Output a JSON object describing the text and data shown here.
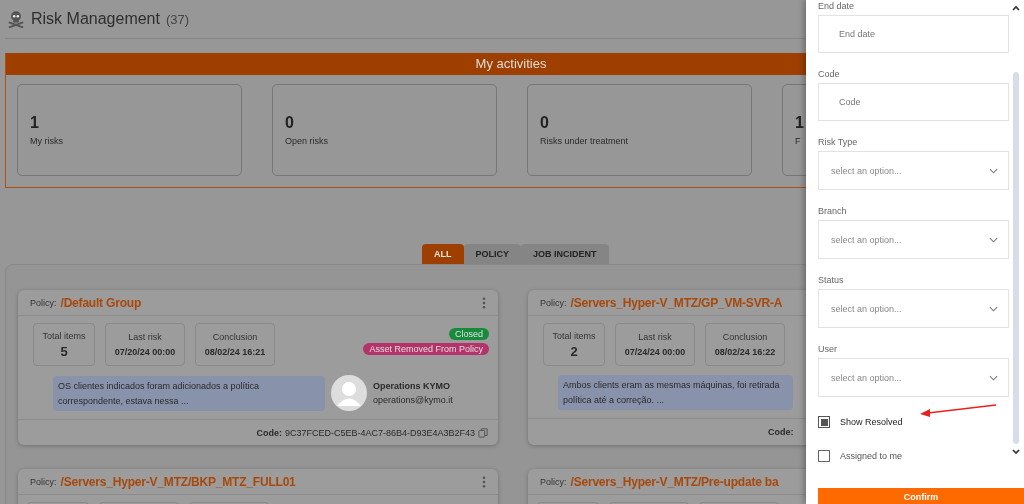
{
  "page": {
    "title": "Risk Management",
    "count": "(37)"
  },
  "activities": {
    "title": "My activities",
    "stats": [
      {
        "value": "1",
        "label": "My risks"
      },
      {
        "value": "0",
        "label": "Open risks"
      },
      {
        "value": "0",
        "label": "Risks under treatment"
      },
      {
        "value": "1",
        "label": "F"
      }
    ]
  },
  "tabs": [
    {
      "label": "ALL",
      "selected": true
    },
    {
      "label": "POLICY",
      "selected": false
    },
    {
      "label": "JOB INCIDENT",
      "selected": false
    }
  ],
  "policies": [
    {
      "policy_label": "Policy:",
      "name": "/Default Group",
      "metrics": [
        {
          "label": "Total items",
          "value": "5",
          "kind": "count"
        },
        {
          "label": "Last risk",
          "value": "07/20/24 00:00",
          "kind": "date"
        },
        {
          "label": "Conclusion",
          "value": "08/02/24 16:21",
          "kind": "date"
        }
      ],
      "badges": [
        {
          "text": "Closed",
          "color": "#178a3c"
        },
        {
          "text": "Asset Removed From Policy",
          "color": "#b3336a"
        }
      ],
      "comment": "OS clientes indicados foram adicionados a política correspondente, estava nessa ...",
      "user": {
        "name": "Operations KYMO",
        "email": "operations@kymo.it"
      },
      "code_label": "Code:",
      "code": "9C37FCED-C5EB-4AC7-86B4-D93E4A3B2F43"
    },
    {
      "policy_label": "Policy:",
      "name": "/Servers_Hyper-V_MTZ/GP_VM-SVR-A",
      "metrics": [
        {
          "label": "Total items",
          "value": "2",
          "kind": "count"
        },
        {
          "label": "Last risk",
          "value": "07/24/24 00:00",
          "kind": "date"
        },
        {
          "label": "Conclusion",
          "value": "08/02/24 16:22",
          "kind": "date"
        }
      ],
      "comment": "Ambos clients eram as mesmas máquinas, foi retirada política até a correção. ...",
      "code_label": "Code:"
    },
    {
      "policy_label": "Policy:",
      "name": "/Servers_Hyper-V_MTZ/BKP_MTZ_FULL01"
    },
    {
      "policy_label": "Policy:",
      "name": "/Servers_Hyper-V_MTZ/Pre-update ba"
    }
  ],
  "filters": [
    {
      "label": "End date",
      "kind": "text",
      "placeholder": "End date"
    },
    {
      "label": "Code",
      "kind": "text",
      "placeholder": "Code"
    },
    {
      "label": "Risk Type",
      "kind": "select",
      "placeholder": "select an option..."
    },
    {
      "label": "Branch",
      "kind": "select",
      "placeholder": "select an option..."
    },
    {
      "label": "Status",
      "kind": "select",
      "placeholder": "select an option..."
    },
    {
      "label": "User",
      "kind": "select",
      "placeholder": "select an option..."
    }
  ],
  "checkboxes": [
    {
      "label": "Show Resolved",
      "checked": true
    },
    {
      "label": "Assigned to me",
      "checked": false
    }
  ],
  "confirm": "Confirm"
}
